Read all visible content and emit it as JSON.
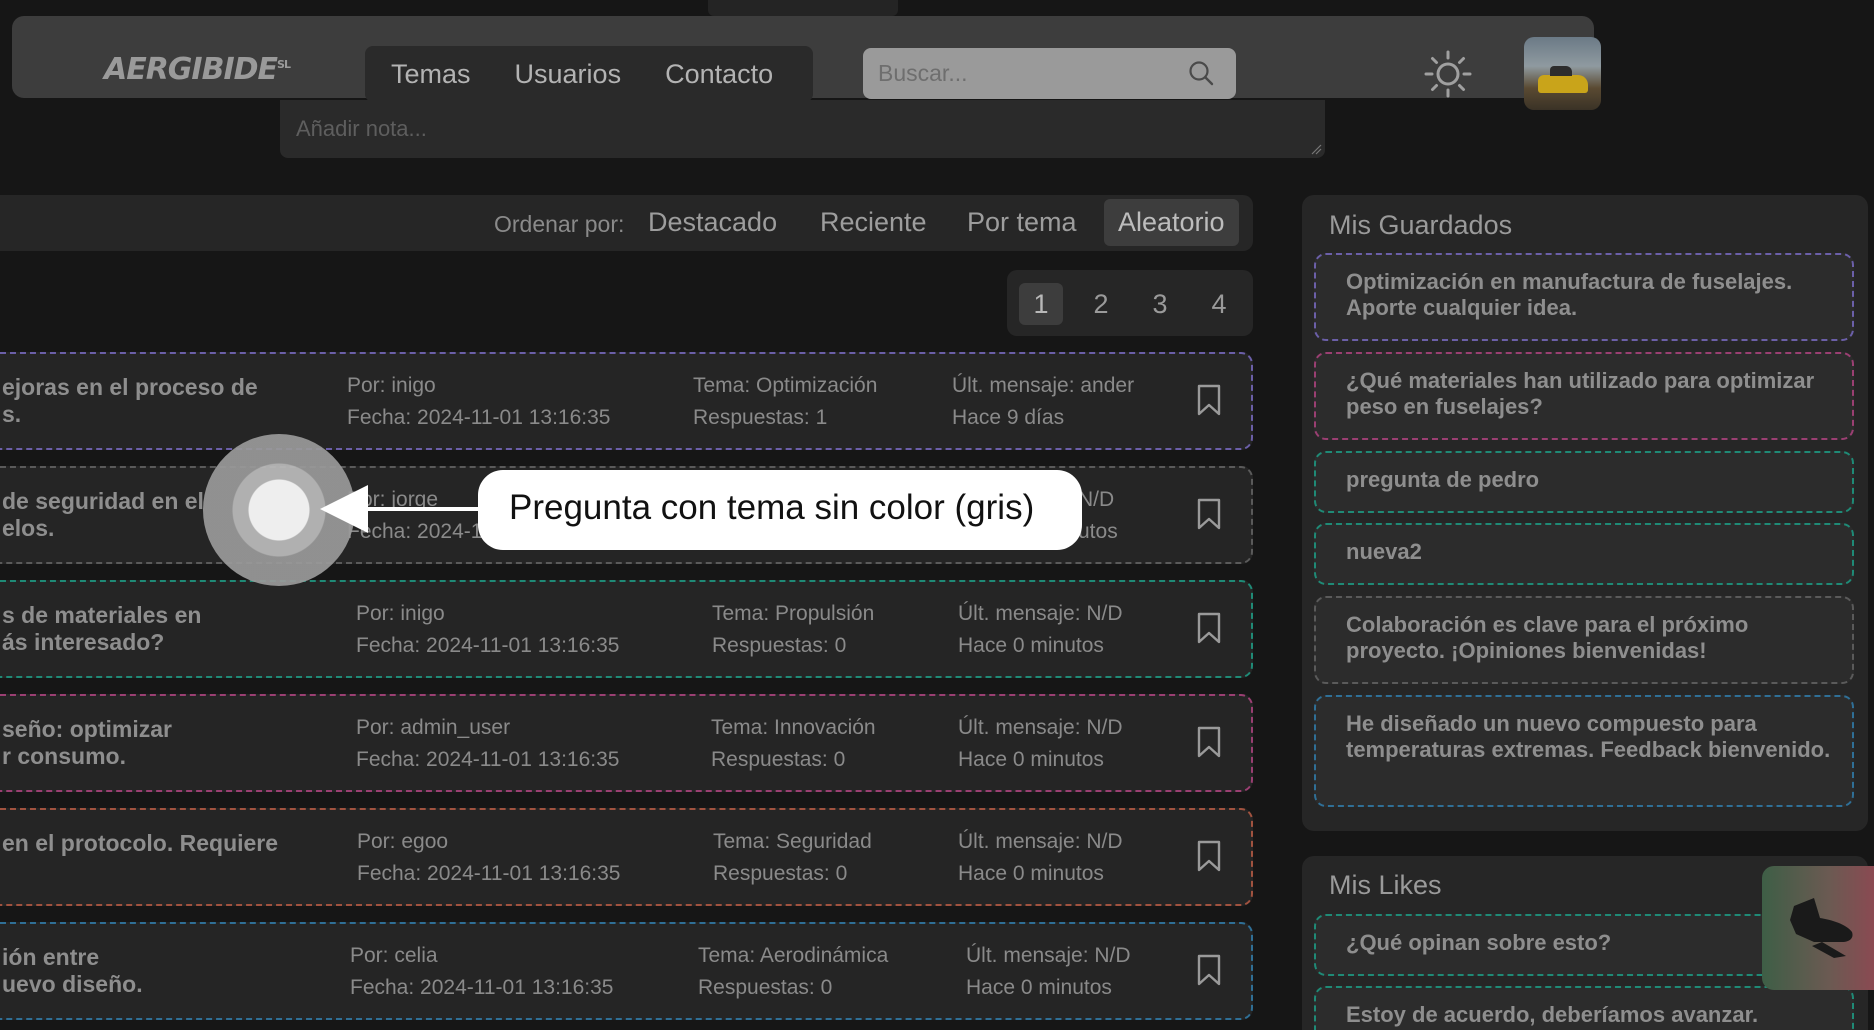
{
  "header": {
    "logo": "AERGIBIDE",
    "logo_suffix": "SL",
    "nav": [
      "Temas",
      "Usuarios",
      "Contacto"
    ],
    "search_placeholder": "Buscar..."
  },
  "note": {
    "placeholder": "Añadir nota..."
  },
  "sort": {
    "label": "Ordenar por:",
    "options": [
      "Destacado",
      "Reciente",
      "Por tema",
      "Aleatorio"
    ],
    "active": "Aleatorio"
  },
  "pagination": {
    "pages": [
      "1",
      "2",
      "3",
      "4"
    ],
    "current": "1"
  },
  "questions": [
    {
      "title": "ejoras en el proceso de\ns.",
      "author": "Por: inigo",
      "date": "Fecha: 2024-11-01 13:16:35",
      "topic": "Tema: Optimización",
      "replies": "Respuestas: 1",
      "last": "Últ. mensaje: ander",
      "ago": "Hace 9 días",
      "color": "#6b5fa8"
    },
    {
      "title": "de seguridad en el\nelos.",
      "author": "Por: jorge",
      "date": "Fecha: 2024-1",
      "topic": "",
      "replies": "",
      "last": "N/D",
      "ago": "utos",
      "color": "#5a5a5a"
    },
    {
      "title": "s de materiales en\nás interesado?",
      "author": "Por: inigo",
      "date": "Fecha: 2024-11-01 13:16:35",
      "topic": "Tema: Propulsión",
      "replies": "Respuestas: 0",
      "last": "Últ. mensaje: N/D",
      "ago": "Hace 0 minutos",
      "color": "#1f8a76"
    },
    {
      "title": "seño: optimizar\nr consumo.",
      "author": "Por: admin_user",
      "date": "Fecha: 2024-11-01 13:16:35",
      "topic": "Tema: Innovación",
      "replies": "Respuestas: 0",
      "last": "Últ. mensaje: N/D",
      "ago": "Hace 0 minutos",
      "color": "#9a3f72"
    },
    {
      "title": "en el protocolo. Requiere",
      "author": "Por: egoo",
      "date": "Fecha: 2024-11-01 13:16:35",
      "topic": "Tema: Seguridad",
      "replies": "Respuestas: 0",
      "last": "Últ. mensaje: N/D",
      "ago": "Hace 0 minutos",
      "color": "#a0523f"
    },
    {
      "title": "ión entre\nuevo diseño.",
      "author": "Por: celia",
      "date": "Fecha: 2024-11-01 13:16:35",
      "topic": "Tema: Aerodinámica",
      "replies": "Respuestas: 0",
      "last": "Últ. mensaje: N/D",
      "ago": "Hace 0 minutos",
      "color": "#2f6f96"
    }
  ],
  "saved": {
    "title": "Mis Guardados",
    "items": [
      {
        "text": "Optimización en manufactura de fuselajes. Aporte cualquier idea.",
        "color": "#6b5fa8"
      },
      {
        "text": "¿Qué materiales han utilizado para optimizar peso en fuselajes?",
        "color": "#9a3f72"
      },
      {
        "text": "pregunta de pedro",
        "color": "#1f8a76"
      },
      {
        "text": "nueva2",
        "color": "#1f8a76"
      },
      {
        "text": "Colaboración es clave para el próximo proyecto. ¡Opiniones bienvenidas!",
        "color": "#5a5a5a"
      },
      {
        "text": "He diseñado un nuevo compuesto para temperaturas extremas. Feedback bienvenido.",
        "color": "#2f6f96"
      }
    ]
  },
  "likes": {
    "title": "Mis Likes",
    "items": [
      {
        "text": "¿Qué opinan sobre esto?",
        "color": "#1f8a76"
      },
      {
        "text": "Estoy de acuerdo, deberíamos avanzar.",
        "color": "#1f8a76"
      }
    ]
  },
  "tooltip": {
    "text": "Pregunta con tema sin color (gris)"
  },
  "colors": {
    "background": "#161616",
    "header": "#3d3d3d",
    "panel": "#262626"
  }
}
